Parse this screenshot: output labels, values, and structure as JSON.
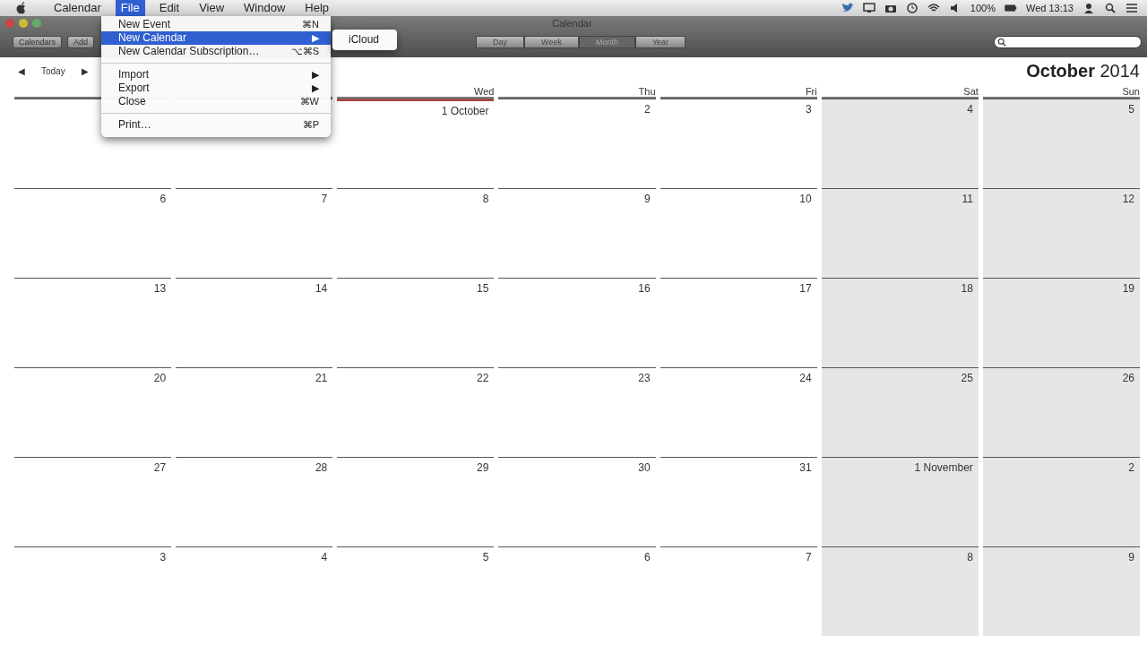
{
  "menu_bar": {
    "items": [
      {
        "label": "Calendar",
        "selected": false
      },
      {
        "label": "File",
        "selected": true
      },
      {
        "label": "Edit",
        "selected": false
      },
      {
        "label": "View",
        "selected": false
      },
      {
        "label": "Window",
        "selected": false
      },
      {
        "label": "Help",
        "selected": false
      }
    ],
    "battery": "100%",
    "clock": "Wed 13:13"
  },
  "window": {
    "title": "Calendar"
  },
  "toolbar": {
    "left_buttons": [
      "Calendars",
      "Add"
    ],
    "views": [
      {
        "label": "Day",
        "selected": false
      },
      {
        "label": "Week",
        "selected": false
      },
      {
        "label": "Month",
        "selected": true
      },
      {
        "label": "Year",
        "selected": false
      }
    ]
  },
  "nav": {
    "prev": "◀",
    "today": "Today",
    "next": "▶"
  },
  "heading": {
    "month": "October",
    "year": "2014"
  },
  "weekdays": [
    {
      "label": "Wed"
    },
    {
      "label": "Thu"
    },
    {
      "label": "Fri"
    },
    {
      "label": "Sat"
    },
    {
      "label": "Sun"
    }
  ],
  "weeks": [
    [
      {
        "weekend": false,
        "today": false
      },
      {
        "weekend": false,
        "today": false
      },
      {
        "date": "1 October",
        "weekend": false,
        "today": true
      },
      {
        "date": "2",
        "weekend": false,
        "today": false
      },
      {
        "date": "3",
        "weekend": false,
        "today": false
      },
      {
        "date": "4",
        "weekend": true,
        "today": false
      },
      {
        "date": "5",
        "weekend": true,
        "today": false
      }
    ],
    [
      {
        "date": "6",
        "weekend": false,
        "today": false
      },
      {
        "date": "7",
        "weekend": false,
        "today": false
      },
      {
        "date": "8",
        "weekend": false,
        "today": false
      },
      {
        "date": "9",
        "weekend": false,
        "today": false
      },
      {
        "date": "10",
        "weekend": false,
        "today": false
      },
      {
        "date": "11",
        "weekend": true,
        "today": false
      },
      {
        "date": "12",
        "weekend": true,
        "today": false
      }
    ],
    [
      {
        "date": "13",
        "weekend": false,
        "today": false
      },
      {
        "date": "14",
        "weekend": false,
        "today": false
      },
      {
        "date": "15",
        "weekend": false,
        "today": false
      },
      {
        "date": "16",
        "weekend": false,
        "today": false
      },
      {
        "date": "17",
        "weekend": false,
        "today": false
      },
      {
        "date": "18",
        "weekend": true,
        "today": false
      },
      {
        "date": "19",
        "weekend": true,
        "today": false
      }
    ],
    [
      {
        "date": "20",
        "weekend": false,
        "today": false
      },
      {
        "date": "21",
        "weekend": false,
        "today": false
      },
      {
        "date": "22",
        "weekend": false,
        "today": false
      },
      {
        "date": "23",
        "weekend": false,
        "today": false
      },
      {
        "date": "24",
        "weekend": false,
        "today": false
      },
      {
        "date": "25",
        "weekend": true,
        "today": false
      },
      {
        "date": "26",
        "weekend": true,
        "today": false
      }
    ],
    [
      {
        "date": "27",
        "weekend": false,
        "today": false
      },
      {
        "date": "28",
        "weekend": false,
        "today": false
      },
      {
        "date": "29",
        "weekend": false,
        "today": false
      },
      {
        "date": "30",
        "weekend": false,
        "today": false
      },
      {
        "date": "31",
        "weekend": false,
        "today": false
      },
      {
        "date": "1 November",
        "weekend": true,
        "today": false
      },
      {
        "date": "2",
        "weekend": true,
        "today": false
      }
    ],
    [
      {
        "date": "3",
        "weekend": false,
        "today": false
      },
      {
        "date": "4",
        "weekend": false,
        "today": false
      },
      {
        "date": "5",
        "weekend": false,
        "today": false
      },
      {
        "date": "6",
        "weekend": false,
        "today": false
      },
      {
        "date": "7",
        "weekend": false,
        "today": false
      },
      {
        "date": "8",
        "weekend": true,
        "today": false
      },
      {
        "date": "9",
        "weekend": true,
        "today": false
      }
    ]
  ],
  "file_menu": {
    "items": [
      {
        "kind": "item",
        "label": "New Event",
        "shortcut": "⌘N",
        "selected": false
      },
      {
        "kind": "item",
        "label": "New Calendar",
        "submenu": "▶",
        "selected": true
      },
      {
        "kind": "item",
        "label": "New Calendar Subscription…",
        "shortcut": "⌥⌘S",
        "selected": false
      },
      {
        "kind": "separator"
      },
      {
        "kind": "item",
        "label": "Import",
        "submenu": "▶",
        "selected": false
      },
      {
        "kind": "item",
        "label": "Export",
        "submenu": "▶",
        "selected": false
      },
      {
        "kind": "item",
        "label": "Close",
        "shortcut": "⌘W",
        "selected": false
      },
      {
        "kind": "separator"
      },
      {
        "kind": "item",
        "label": "Print…",
        "shortcut": "⌘P",
        "selected": false
      }
    ],
    "submenu": [
      "iCloud"
    ]
  }
}
